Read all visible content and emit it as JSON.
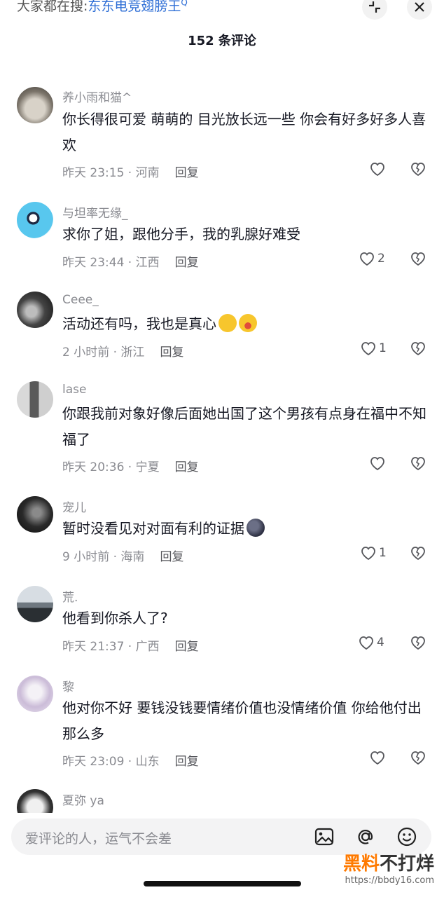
{
  "header": {
    "search_prefix": "大家都在搜:",
    "search_keyword": "东东电竞翅膀王",
    "search_icon_glyph": "Q",
    "comment_count": "152 条评论"
  },
  "comments": [
    {
      "user": "养小雨和猫^",
      "text": "你长得很可爱 萌萌的 目光放长远一些 你会有好多好多人喜欢",
      "time": "昨天 23:15 · 河南",
      "reply": "回复",
      "likes": ""
    },
    {
      "user": "与坦率无缘_",
      "text": "求你了姐，跟他分手，我的乳腺好难受",
      "time": "昨天 23:44 · 江西",
      "reply": "回复",
      "likes": "2"
    },
    {
      "user": "Ceee_",
      "text": "活动还有吗，我也是真心",
      "time": "2 小时前 · 浙江",
      "reply": "回复",
      "likes": "1"
    },
    {
      "user": "lase",
      "text": "你跟我前对象好像后面她出国了这个男孩有点身在福中不知福了",
      "time": "昨天 20:36 · 宁夏",
      "reply": "回复",
      "likes": ""
    },
    {
      "user": "宠儿",
      "text": "暂时没看见对对面有利的证据",
      "time": "9 小时前 · 海南",
      "reply": "回复",
      "likes": "1"
    },
    {
      "user": "荒.",
      "text": "他看到你杀人了?",
      "time": "昨天 21:37 · 广西",
      "reply": "回复",
      "likes": "4"
    },
    {
      "user": "黎",
      "text": "他对你不好  要钱没钱要情绪价值也没情绪价值  你给他付出那么多",
      "time": "昨天 23:09 · 山东",
      "reply": "回复",
      "likes": ""
    },
    {
      "user": "夏弥 ya"
    }
  ],
  "input": {
    "placeholder": "爱评论的人，运气不会差"
  },
  "watermark": {
    "brand_a": "黑料",
    "brand_b": "不打烊",
    "url": "https://bbdy16.com"
  },
  "colors": {
    "accent": "#2f6fd6",
    "muted": "#8a8b91",
    "text": "#161823"
  }
}
